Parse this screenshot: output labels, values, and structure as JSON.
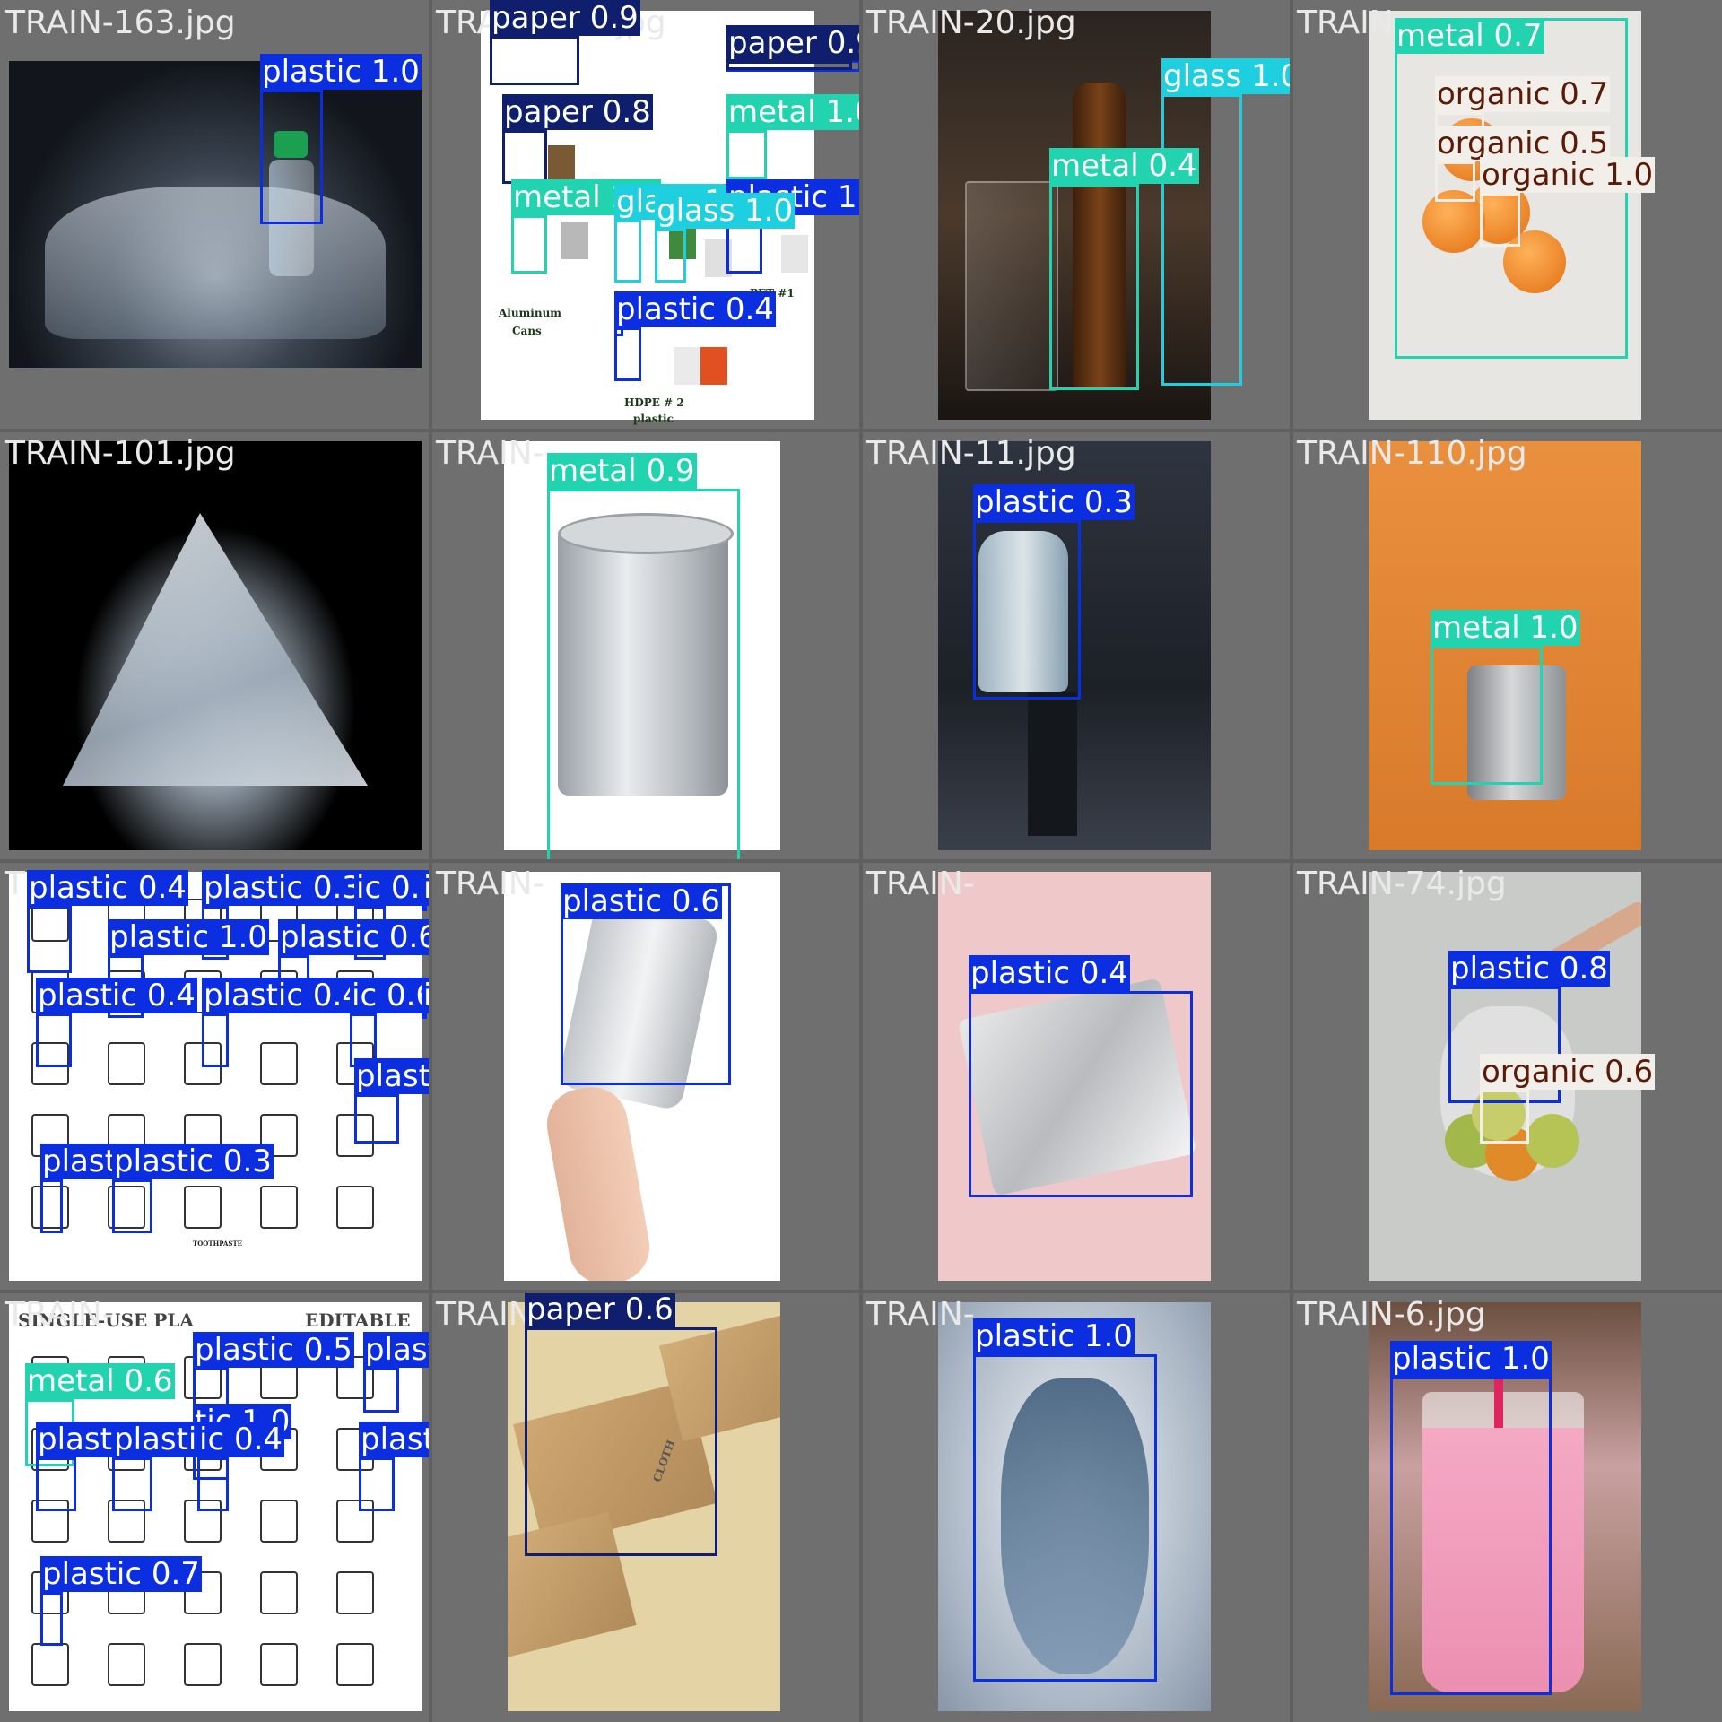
{
  "colors": {
    "plastic": "#0b2fe0",
    "metal": "#22d3b0",
    "paper": "#0f1f6e",
    "glass": "#1ecfe0",
    "organic": "#f2eeea"
  },
  "tiles": [
    {
      "file": "TRAIN-163.jpg",
      "scene": "plastic-pile-dark",
      "dets": [
        {
          "label": "plastic 1.0",
          "cls": "plastic"
        }
      ]
    },
    {
      "file": "TRAIN-305.jpg",
      "scene": "recycling-chart",
      "dets": [
        {
          "label": "paper 0.9",
          "cls": "paper"
        },
        {
          "label": "plastic 0.4",
          "cls": "plastic"
        },
        {
          "label": "paper 0.9",
          "cls": "paper"
        },
        {
          "label": "paper 0.8",
          "cls": "paper"
        },
        {
          "label": "metal 1.0",
          "cls": "metal"
        },
        {
          "label": "metal 1.0",
          "cls": "metal"
        },
        {
          "label": "glass 1.0",
          "cls": "glass"
        },
        {
          "label": "plastic 1.0",
          "cls": "plastic"
        },
        {
          "label": "glass 1.0",
          "cls": "glass"
        },
        {
          "label": "plastic 0.4",
          "cls": "plastic"
        },
        {
          "label": "plastic",
          "cls": "plastic"
        }
      ],
      "printed": [
        "Aluminum",
        "Cans",
        "HDPE # 2",
        "plastic",
        "PET #1"
      ]
    },
    {
      "file": "TRAIN-20.jpg",
      "scene": "glass-bottle",
      "dets": [
        {
          "label": "glass 1.0",
          "cls": "glass"
        },
        {
          "label": "metal 0.4",
          "cls": "metal"
        }
      ]
    },
    {
      "file": "TRAIN-",
      "scene": "orange-net",
      "dets": [
        {
          "label": "metal 0.7",
          "cls": "metal"
        },
        {
          "label": "organic 0.7",
          "cls": "organic"
        },
        {
          "label": "organic 0.5",
          "cls": "organic"
        },
        {
          "label": "organic 1.0",
          "cls": "organic"
        }
      ]
    },
    {
      "file": "TRAIN-101.jpg",
      "scene": "plastic-heap",
      "dets": []
    },
    {
      "file": "TRAIN-",
      "scene": "paint-can",
      "dets": [
        {
          "label": "metal 0.9",
          "cls": "metal"
        }
      ]
    },
    {
      "file": "TRAIN-11.jpg",
      "scene": "water-jug",
      "dets": [
        {
          "label": "plastic 0.3",
          "cls": "plastic"
        }
      ]
    },
    {
      "file": "TRAIN-110.jpg",
      "scene": "crushed-can",
      "dets": [
        {
          "label": "metal 1.0",
          "cls": "metal"
        }
      ]
    },
    {
      "file": "TRAIN-",
      "scene": "icon-sheet",
      "dets": [
        {
          "label": "plastic 0.4",
          "cls": "plastic"
        },
        {
          "label": "plastic 0.3",
          "cls": "plastic"
        },
        {
          "label": "ic 0.9",
          "cls": "plastic"
        },
        {
          "label": "ic 0.9",
          "cls": "plastic"
        },
        {
          "label": "plastic 1.0",
          "cls": "plastic"
        },
        {
          "label": "plastic 0.6",
          "cls": "plastic"
        },
        {
          "label": "plastic 0.4",
          "cls": "plastic"
        },
        {
          "label": "plastic 0.4",
          "cls": "plastic"
        },
        {
          "label": "ic 0.6",
          "cls": "plastic"
        },
        {
          "label": "ic 0.7",
          "cls": "plastic"
        },
        {
          "label": "plastic 0.8",
          "cls": "plastic"
        },
        {
          "label": "plast",
          "cls": "plastic"
        },
        {
          "label": "plastic 0.3",
          "cls": "plastic"
        }
      ],
      "printed": [
        "TOOTHPASTE"
      ]
    },
    {
      "file": "TRAIN-",
      "scene": "hand-can",
      "dets": [
        {
          "label": "plastic 0.6",
          "cls": "plastic"
        }
      ]
    },
    {
      "file": "TRAIN-",
      "scene": "pills",
      "dets": [
        {
          "label": "plastic 0.4",
          "cls": "plastic"
        }
      ]
    },
    {
      "file": "TRAIN-74.jpg",
      "scene": "fruit-bag",
      "dets": [
        {
          "label": "plastic 0.8",
          "cls": "plastic"
        },
        {
          "label": "organic 0.6",
          "cls": "organic"
        }
      ]
    },
    {
      "file": "TRAIN-",
      "scene": "icon-sheet-2",
      "dets": [
        {
          "label": "plastic 0.5",
          "cls": "plastic"
        },
        {
          "label": "plastic 0.8",
          "cls": "plastic"
        },
        {
          "label": "metal 0.6",
          "cls": "metal"
        },
        {
          "label": "tic 1.0",
          "cls": "plastic"
        },
        {
          "label": "plasti",
          "cls": "plastic"
        },
        {
          "label": "plastic 0.3",
          "cls": "plastic"
        },
        {
          "label": "ic 0.4",
          "cls": "plastic"
        },
        {
          "label": "plastic 0.8",
          "cls": "plastic"
        },
        {
          "label": "plastic 0.7",
          "cls": "plastic"
        }
      ],
      "printed": [
        "SINGLE-USE PLA",
        "EDITABLE"
      ]
    },
    {
      "file": "TRAIN-",
      "scene": "boxes",
      "dets": [
        {
          "label": "paper 0.6",
          "cls": "paper"
        }
      ],
      "printed": [
        "CLOTH"
      ]
    },
    {
      "file": "TRAIN-",
      "scene": "blue-bag",
      "dets": [
        {
          "label": "plastic 1.0",
          "cls": "plastic"
        }
      ]
    },
    {
      "file": "TRAIN-6.jpg",
      "scene": "pink-drink",
      "dets": [
        {
          "label": "plastic 1.0",
          "cls": "plastic"
        }
      ]
    }
  ]
}
